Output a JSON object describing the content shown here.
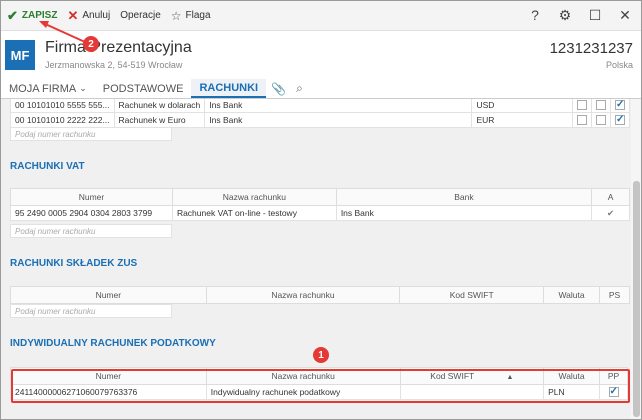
{
  "toolbar": {
    "save_label": "ZAPISZ",
    "cancel_label": "Anuluj",
    "operations_label": "Operacje",
    "flag_label": "Flaga"
  },
  "header": {
    "logo": "MF",
    "company": "Firma Prezentacyjna",
    "address": "Jerzmanowska 2, 54-519 Wrocław",
    "nip": "1231231237",
    "country": "Polska"
  },
  "tabs": [
    "MOJA FIRMA",
    "PODSTAWOWE",
    "RACHUNKI"
  ],
  "accounts": {
    "rows": [
      {
        "number": "00 10101010 5555 555...",
        "name": "Rachunek w dolarach",
        "bank": "Ins Bank",
        "currency": "USD"
      },
      {
        "number": "00 10101010 2222 222...",
        "name": "Rachunek w Euro",
        "bank": "Ins Bank",
        "currency": "EUR"
      }
    ],
    "placeholder": "Podaj numer rachunku"
  },
  "vat": {
    "title": "RACHUNKI VAT",
    "headers": [
      "Numer",
      "Nazwa rachunku",
      "Bank",
      "A"
    ],
    "rows": [
      {
        "number": "95 2490 0005 2904 0304 2803 3799",
        "name": "Rachunek VAT on-line - testowy",
        "bank": "Ins Bank"
      }
    ],
    "placeholder": "Podaj numer rachunku"
  },
  "zus": {
    "title": "RACHUNKI SKŁADEK ZUS",
    "headers": [
      "Numer",
      "Nazwa rachunku",
      "Kod SWIFT",
      "Waluta",
      "PS"
    ],
    "placeholder": "Podaj numer rachunku"
  },
  "tax": {
    "title": "INDYWIDUALNY RACHUNEK PODATKOWY",
    "headers": [
      "Numer",
      "Nazwa rachunku",
      "Kod SWIFT",
      "Waluta",
      "PP"
    ],
    "rows": [
      {
        "number": "24114000006271060079763376",
        "name": "Indywidualny rachunek podatkowy",
        "swift": "",
        "currency": "PLN"
      }
    ]
  },
  "annotations": {
    "badge1": "1",
    "badge2": "2"
  },
  "colors": {
    "accent": "#1a6fb5",
    "save": "#2e7d32",
    "cancel": "#d32f2f",
    "annotation": "#e53935"
  }
}
